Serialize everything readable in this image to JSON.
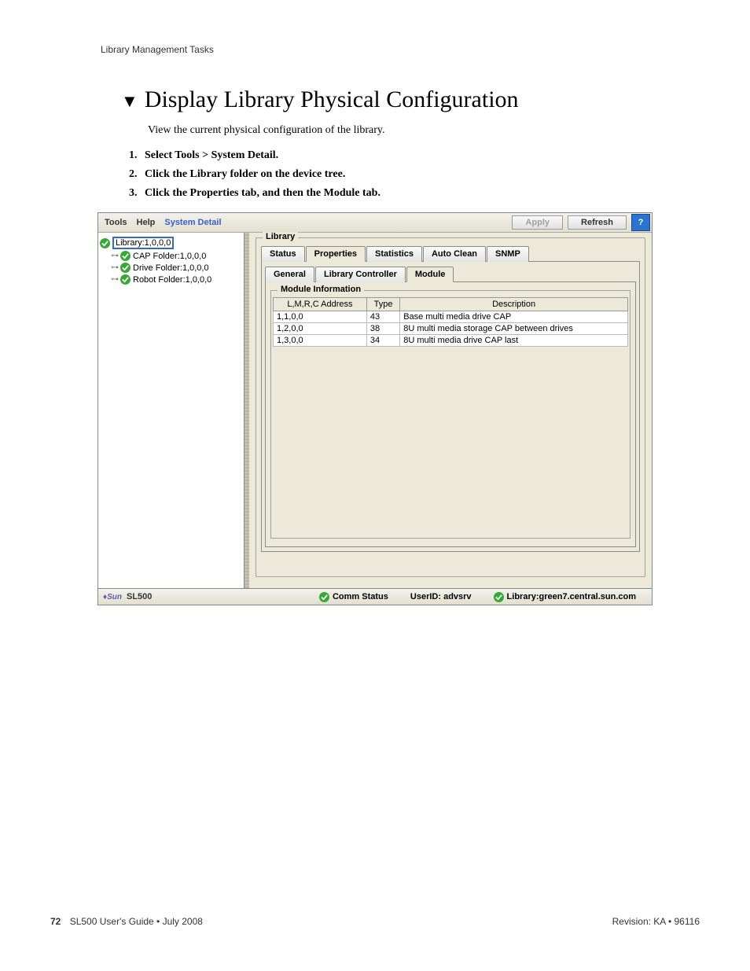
{
  "doc": {
    "running_head": "Library Management Tasks",
    "title": "Display Library Physical Configuration",
    "intro": "View the current physical configuration of the library.",
    "steps": [
      "Select Tools > System Detail.",
      "Click the Library folder on the device tree.",
      "Click the Properties tab, and then the Module tab."
    ],
    "footer": {
      "page": "72",
      "book": "SL500 User's Guide  •  July 2008",
      "rev": "Revision: KA  •  96116"
    }
  },
  "ss": {
    "menubar": {
      "tools": "Tools",
      "help": "Help",
      "sysdetail": "System Detail"
    },
    "buttons": {
      "apply": "Apply",
      "refresh": "Refresh",
      "help": "?"
    },
    "tree": {
      "root": "Library:1,0,0,0",
      "children": [
        "CAP Folder:1,0,0,0",
        "Drive Folder:1,0,0,0",
        "Robot Folder:1,0,0,0"
      ]
    },
    "panel": {
      "legend": "Library",
      "tabs1": [
        "Status",
        "Properties",
        "Statistics",
        "Auto Clean",
        "SNMP"
      ],
      "tabs1_active": 1,
      "tabs2": [
        "General",
        "Library Controller",
        "Module"
      ],
      "tabs2_active": 2,
      "group": "Module Information",
      "cols": [
        "L,M,R,C Address",
        "Type",
        "Description"
      ],
      "rows": [
        [
          "1,1,0,0",
          "43",
          "Base multi media drive CAP"
        ],
        [
          "1,2,0,0",
          "38",
          "8U multi media storage CAP between drives"
        ],
        [
          "1,3,0,0",
          "34",
          "8U multi media drive CAP last"
        ]
      ]
    },
    "status": {
      "model": "SL500",
      "comm": "Comm Status",
      "user": "UserID: advsrv",
      "lib": "Library:green7.central.sun.com"
    }
  }
}
